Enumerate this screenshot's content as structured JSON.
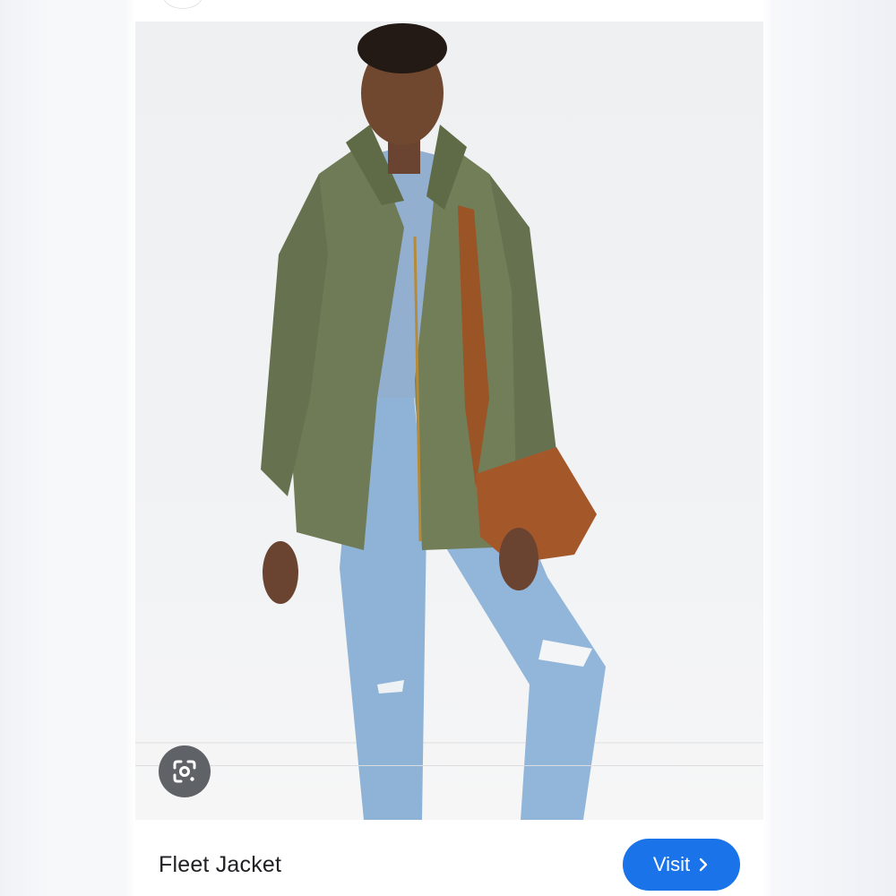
{
  "result": {
    "title": "Fleet Jacket",
    "visit_label": "Visit"
  },
  "icons": {
    "lens": "google-lens-icon",
    "chevron": "chevron-right-icon"
  },
  "colors": {
    "visit_button": "#1a73e8",
    "lens_button": "#5f6368",
    "jacket": "#6f7b56",
    "jeans": "#8fb3d6",
    "bag": "#a4582a"
  }
}
